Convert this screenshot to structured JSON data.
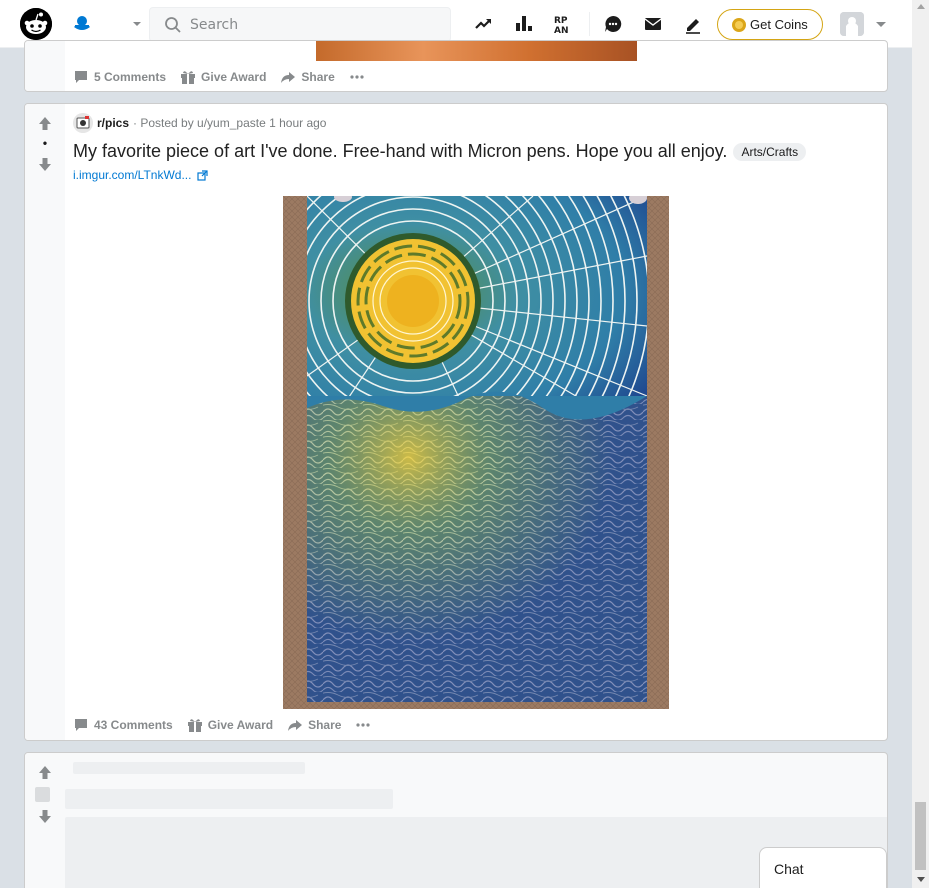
{
  "header": {
    "search_placeholder": "Search",
    "get_coins_label": "Get Coins",
    "icons": [
      "reddit-logo",
      "home-icon",
      "popular-icon",
      "leaderboard-icon",
      "rpan-icon",
      "chat-icon",
      "mail-icon",
      "create-post-icon",
      "coins-icon",
      "avatar"
    ]
  },
  "prev_post": {
    "comments_label": "5 Comments",
    "award_label": "Give Award",
    "share_label": "Share"
  },
  "post": {
    "subreddit": "r/pics",
    "posted_by": "· Posted by u/yum_paste 1 hour ago",
    "score": "•",
    "title": "My favorite piece of art I've done. Free-hand with Micron pens. Hope you all enjoy.",
    "flair": "Arts/Crafts",
    "link": "i.imgur.com/LTnkWd...",
    "comments_label": "43 Comments",
    "award_label": "Give Award",
    "share_label": "Share"
  },
  "chat": {
    "label": "Chat"
  },
  "colors": {
    "brand": "#ff4500",
    "link": "#0079d3",
    "coin_border": "#d4a514",
    "page_bg": "#dae0e6"
  }
}
